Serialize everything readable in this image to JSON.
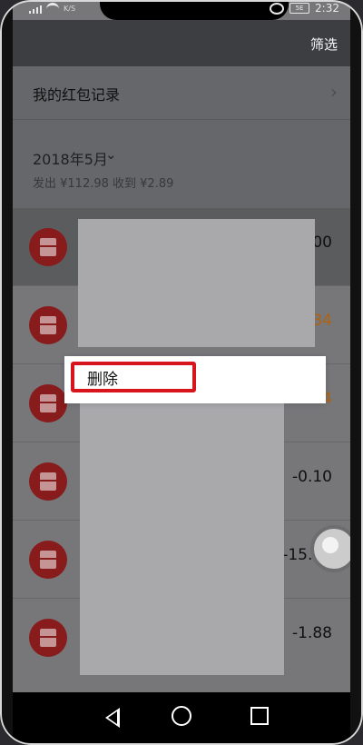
{
  "status": {
    "network": "K/S",
    "battery": "5E",
    "time": "2:32"
  },
  "header": {
    "filter_label": "筛选"
  },
  "records": {
    "label": "我的红包记录"
  },
  "month": {
    "label": "2018年5月",
    "summary": "发出 ¥112.98 收到 ¥2.89"
  },
  "items": [
    {
      "amount": "0.00",
      "color": "#111111"
    },
    {
      "amount": "0.34",
      "color": "#b7660f"
    },
    {
      "amount": "54",
      "color": "#b7660f"
    },
    {
      "amount": "-0.10",
      "color": "#111111"
    },
    {
      "amount": "-15.00",
      "color": "#111111"
    },
    {
      "amount": "-1.88",
      "color": "#111111"
    }
  ],
  "context_menu": {
    "delete_label": "删除"
  },
  "icons": {
    "red_packet": "red-envelope-icon",
    "chevron_right": "chevron-right-icon",
    "chevron_down": "chevron-down-icon",
    "nav_back": "back-triangle-icon",
    "nav_home": "home-circle-icon",
    "nav_recent": "recent-square-icon"
  }
}
